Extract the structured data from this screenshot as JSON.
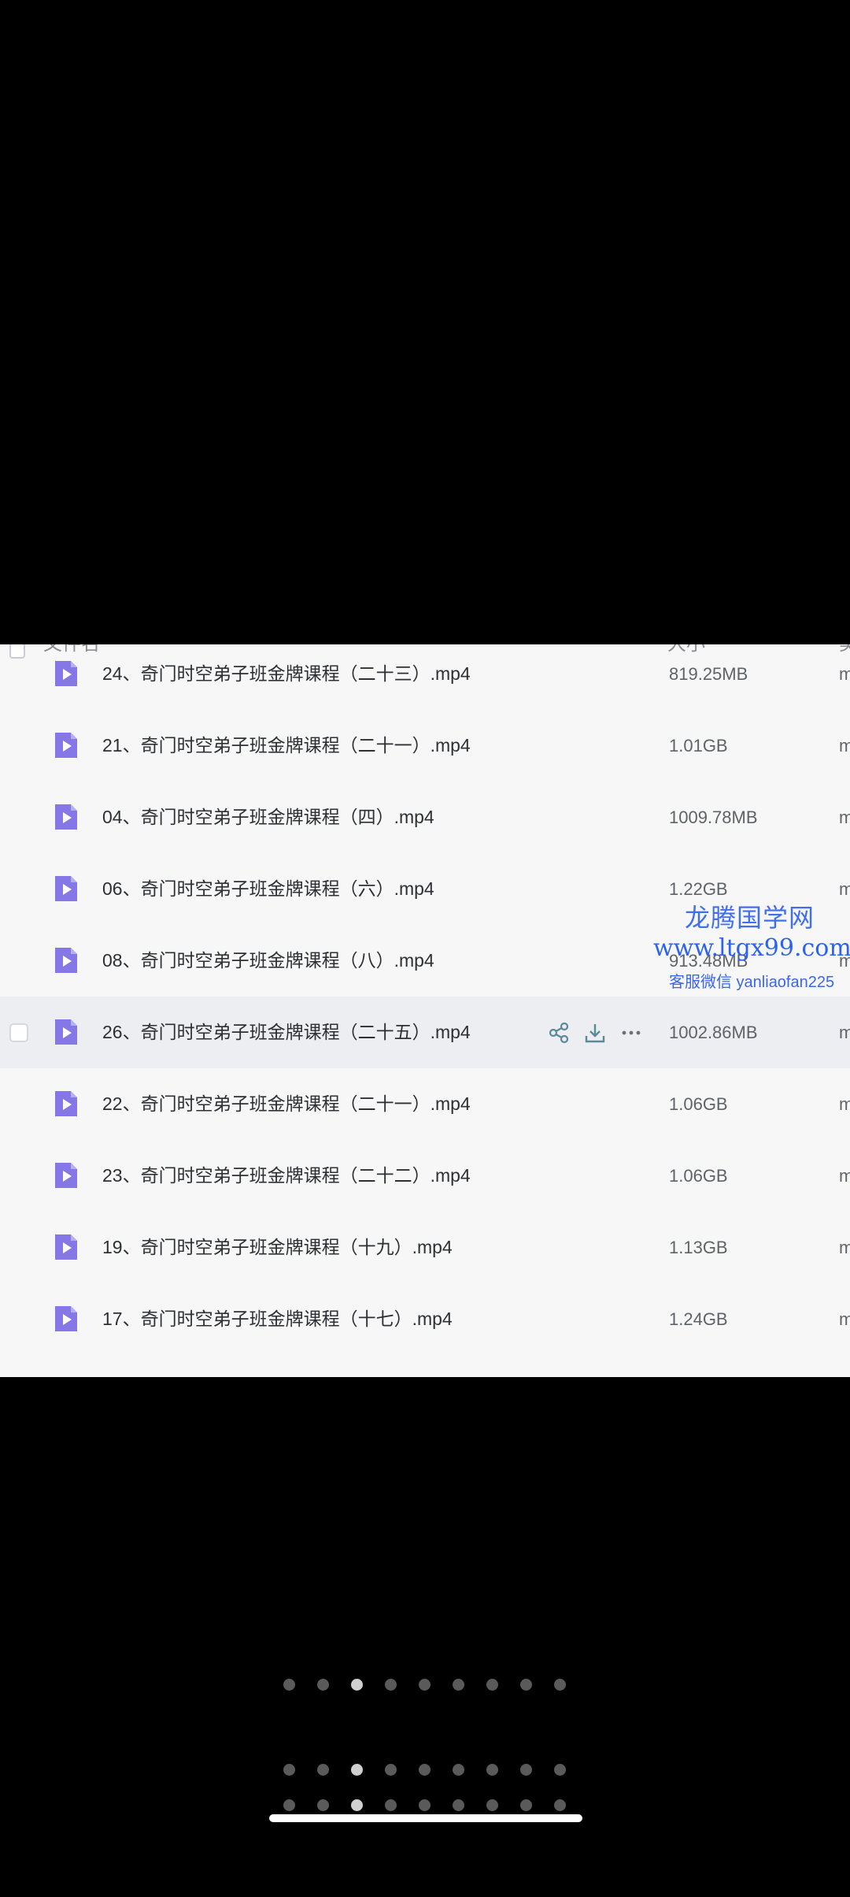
{
  "header": {
    "name_label": "文件名",
    "size_label": "大小",
    "extra_label": "类"
  },
  "files": [
    {
      "name": "24、奇门时空弟子班金牌课程（二十三）.mp4",
      "size": "819.25MB",
      "extra": "m"
    },
    {
      "name": "21、奇门时空弟子班金牌课程（二十一）.mp4",
      "size": "1.01GB",
      "extra": "m"
    },
    {
      "name": "04、奇门时空弟子班金牌课程（四）.mp4",
      "size": "1009.78MB",
      "extra": "m"
    },
    {
      "name": "06、奇门时空弟子班金牌课程（六）.mp4",
      "size": "1.22GB",
      "extra": "m"
    },
    {
      "name": "08、奇门时空弟子班金牌课程（八）.mp4",
      "size": "913.48MB",
      "extra": "m"
    },
    {
      "name": "26、奇门时空弟子班金牌课程（二十五）.mp4",
      "size": "1002.86MB",
      "extra": "m"
    },
    {
      "name": "22、奇门时空弟子班金牌课程（二十一）.mp4",
      "size": "1.06GB",
      "extra": "m"
    },
    {
      "name": "23、奇门时空弟子班金牌课程（二十二）.mp4",
      "size": "1.06GB",
      "extra": "m"
    },
    {
      "name": "19、奇门时空弟子班金牌课程（十九）.mp4",
      "size": "1.13GB",
      "extra": "m"
    },
    {
      "name": "17、奇门时空弟子班金牌课程（十七）.mp4",
      "size": "1.24GB",
      "extra": "m"
    }
  ],
  "hover_row_index": 5,
  "row_actions": [
    "share-icon",
    "download-icon",
    "more-icon"
  ],
  "watermark": {
    "line1": "龙腾国学网",
    "line2": "www.ltgx99.com",
    "line3": "客服微信 yanliaofan225"
  },
  "colors": {
    "file_icon": "#7b6fe0",
    "action_icon": "#5a8a9a",
    "watermark": "#3f6ef0"
  },
  "page_indicator": {
    "count": 9,
    "active_index": 2
  }
}
